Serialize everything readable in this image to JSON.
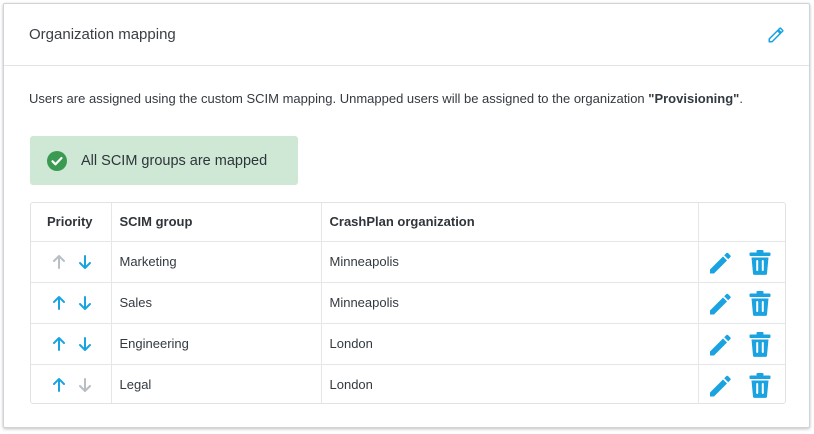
{
  "colors": {
    "accent": "#1aa3e0",
    "disabled_arrow": "#b9bec3",
    "success_bg": "#cfe8d5",
    "success_icon": "#3a9a52"
  },
  "header": {
    "title": "Organization mapping",
    "edit_icon": "pencil-icon"
  },
  "description": {
    "text": "Users are assigned using the custom SCIM mapping. Unmapped users will be assigned to the organization ",
    "org_name": "\"Provisioning\"",
    "suffix": "."
  },
  "alert": {
    "icon": "check-circle-icon",
    "text": "All SCIM groups are mapped"
  },
  "table": {
    "columns": [
      "Priority",
      "SCIM group",
      "CrashPlan organization",
      ""
    ],
    "rows": [
      {
        "scim_group": "Marketing",
        "organization": "Minneapolis",
        "up_enabled": false,
        "down_enabled": true
      },
      {
        "scim_group": "Sales",
        "organization": "Minneapolis",
        "up_enabled": true,
        "down_enabled": true
      },
      {
        "scim_group": "Engineering",
        "organization": "London",
        "up_enabled": true,
        "down_enabled": true
      },
      {
        "scim_group": "Legal",
        "organization": "London",
        "up_enabled": true,
        "down_enabled": false
      }
    ]
  }
}
